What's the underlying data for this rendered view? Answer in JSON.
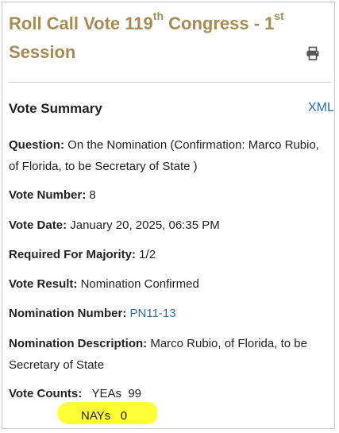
{
  "header": {
    "title_prefix": "Roll Call Vote 119",
    "title_ordinal_suffix": "th",
    "title_middle": " Congress - 1",
    "session_ordinal_suffix": "st",
    "title_end": "Session"
  },
  "summary": {
    "heading": "Vote Summary",
    "xml_link": "XML"
  },
  "fields": {
    "question_label": "Question:",
    "question_value": " On the Nomination (Confirmation: Marco Rubio, of Florida, to be Secretary of State )",
    "vote_number_label": "Vote Number:",
    "vote_number_value": " 8",
    "vote_date_label": "Vote Date:",
    "vote_date_value": " January 20, 2025, 06:35 PM",
    "majority_label": "Required For Majority:",
    "majority_value": " 1/2",
    "result_label": "Vote Result:",
    "result_value": " Nomination Confirmed",
    "nomination_number_label": "Nomination Number:",
    "nomination_number_value": "PN11-13",
    "nomination_description_label": "Nomination Description:",
    "nomination_description_value": " Marco Rubio, of Florida, to be Secretary of State",
    "vote_counts_label": "Vote Counts:",
    "yeas_label": "YEAs",
    "yeas_value": "99",
    "nays_label": "NAYs",
    "nays_value": "0"
  },
  "colors": {
    "title": "#a58c55",
    "link": "#2e6da4",
    "highlight": "#ffff33"
  },
  "icons": {
    "print": "print-icon"
  }
}
